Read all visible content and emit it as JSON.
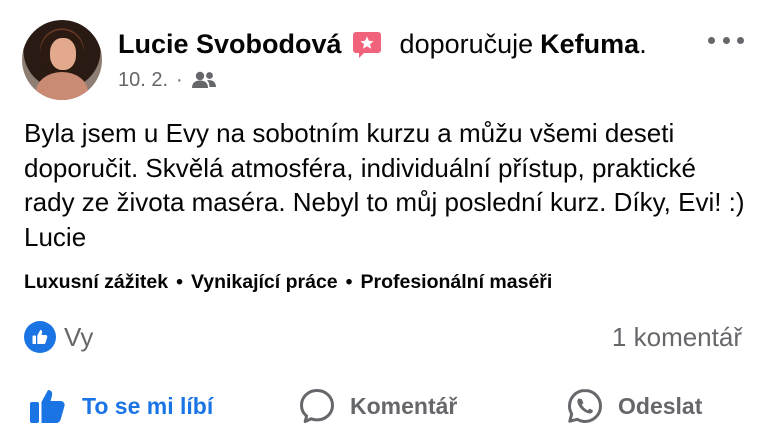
{
  "post": {
    "author": "Lucie Svobodová",
    "verb": "doporučuje",
    "page": "Kefuma",
    "page_suffix": ".",
    "date": "10. 2.",
    "meta_separator": "·",
    "audience_icon": "friends-icon",
    "text": "Byla jsem u Evy na sobotním kurzu a můžu všemi deseti doporučit. Skvělá atmosféra, individuální přístup, praktické rady ze života maséra. Nebyl to můj poslední kurz. Díky, Evi! :) Lucie",
    "tags": [
      "Luxusní zážitek",
      "Vynikající práce",
      "Profesionální maséři"
    ],
    "tag_separator": "•"
  },
  "reactions": {
    "icon": "like-icon",
    "label": "Vy",
    "comments": "1 komentář"
  },
  "actions": {
    "like": "To se mi líbí",
    "comment": "Komentář",
    "share": "Odeslat"
  },
  "colors": {
    "accent": "#1b74e4",
    "secondary_text": "#65676b",
    "badge": "#f0637a"
  }
}
